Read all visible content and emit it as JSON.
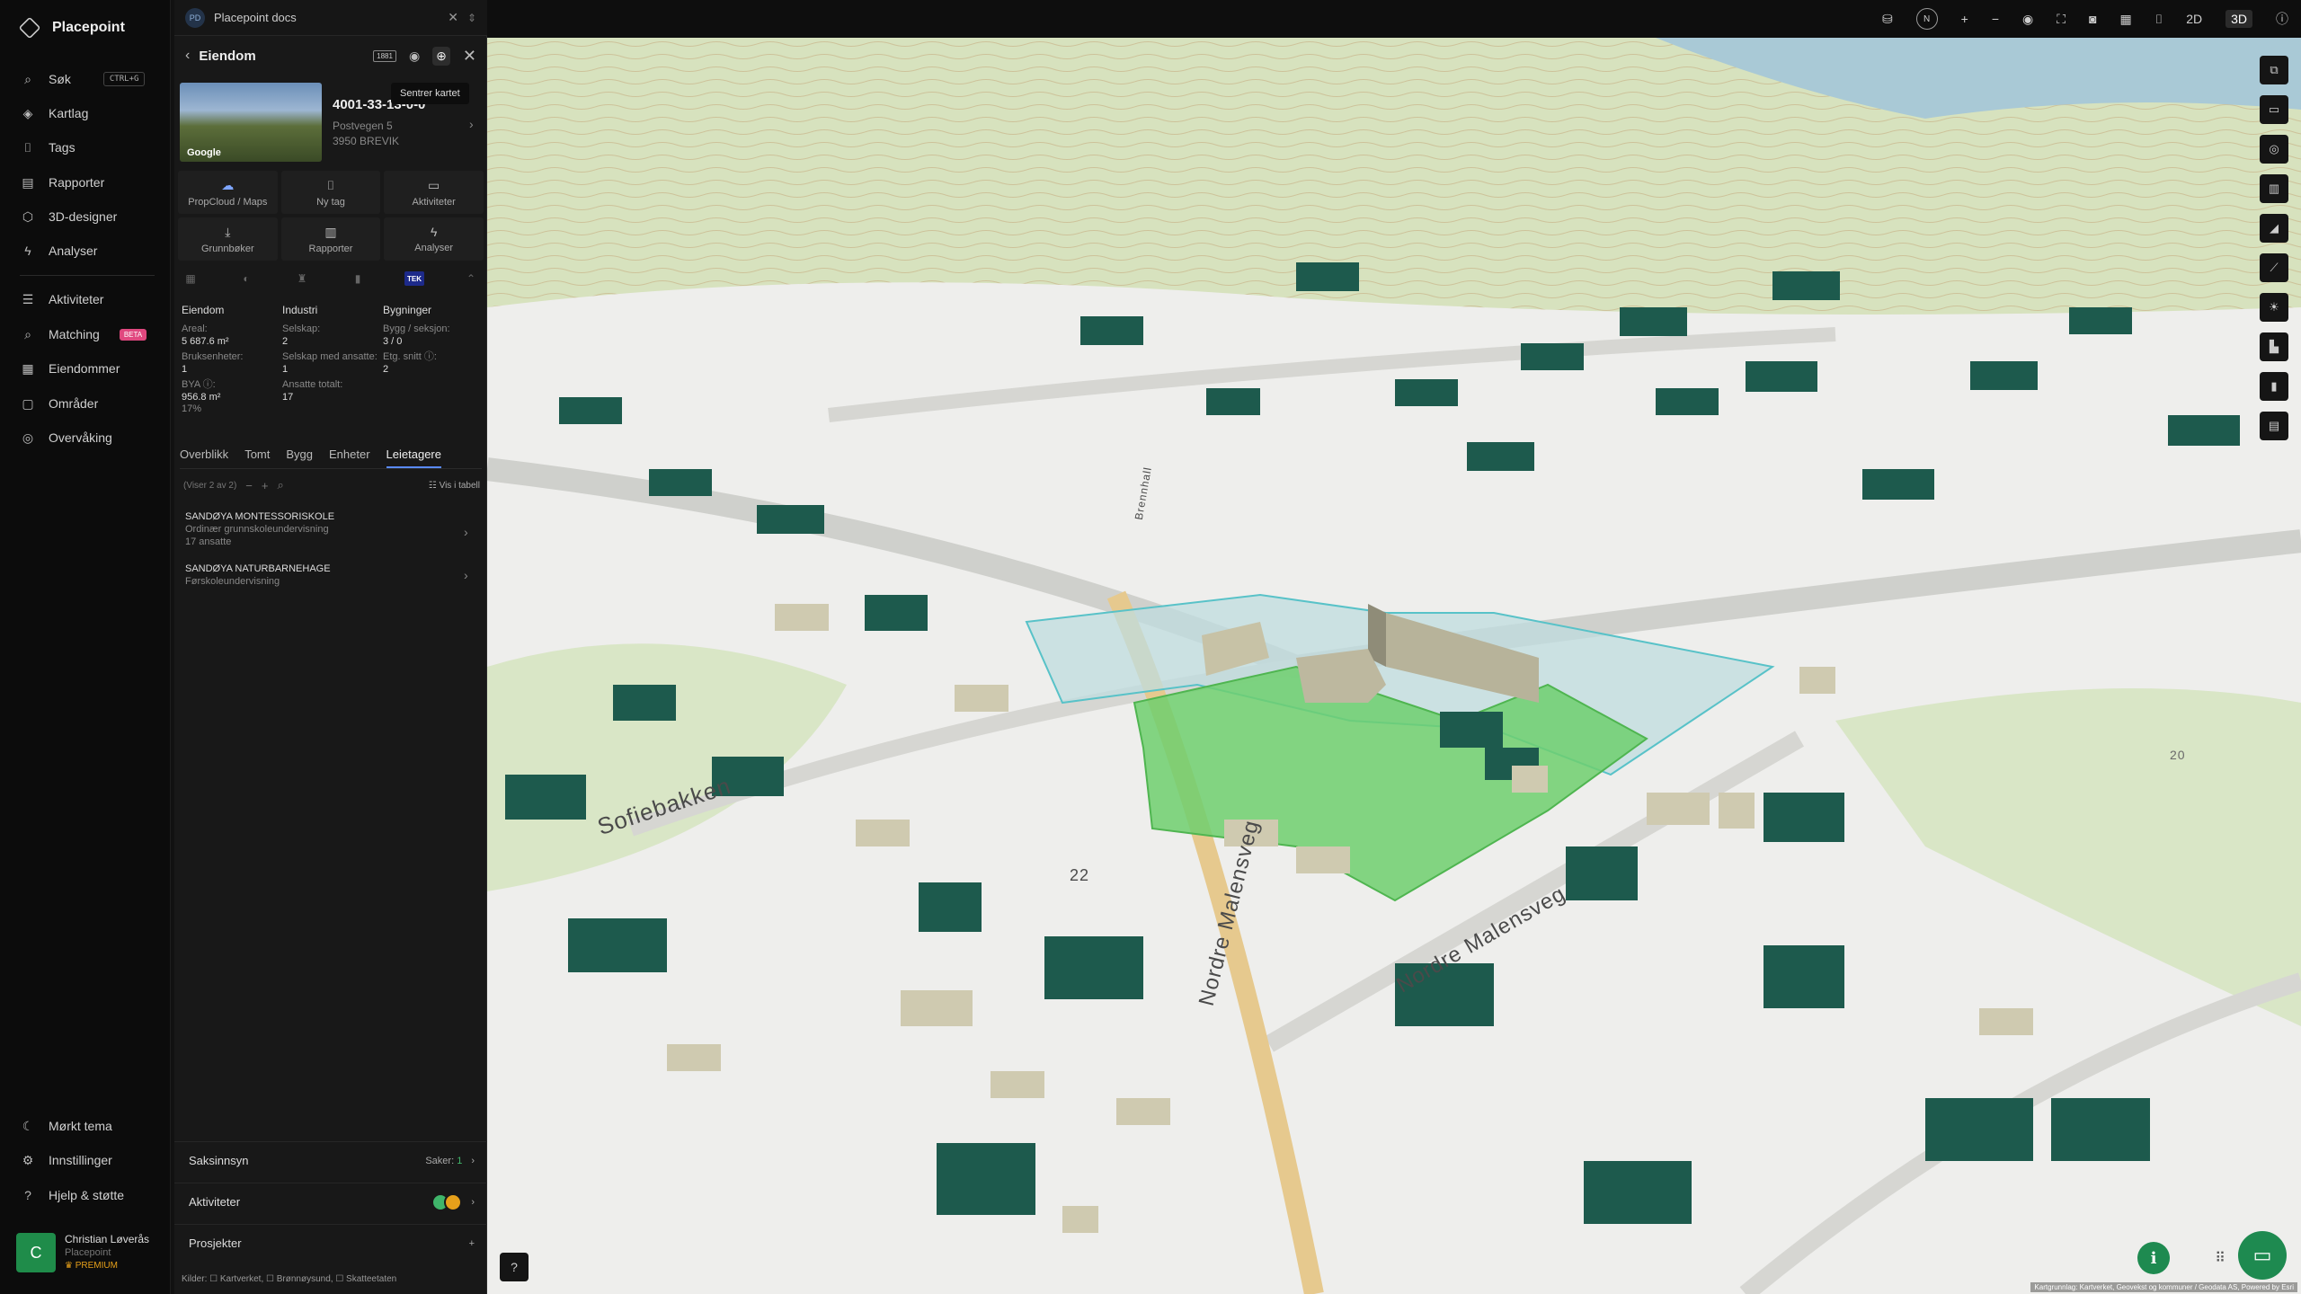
{
  "app": {
    "name": "Placepoint"
  },
  "nav": {
    "search": {
      "label": "Søk",
      "shortcut": "CTRL+G"
    },
    "items": [
      {
        "label": "Kartlag",
        "icon": "layers-icon"
      },
      {
        "label": "Tags",
        "icon": "bookmark-icon"
      },
      {
        "label": "Rapporter",
        "icon": "chart-icon"
      },
      {
        "label": "3D-designer",
        "icon": "cube-icon"
      },
      {
        "label": "Analyser",
        "icon": "bolt-icon"
      }
    ],
    "items2": [
      {
        "label": "Aktiviteter",
        "icon": "activity-icon"
      },
      {
        "label": "Matching",
        "icon": "match-icon",
        "badge": "BETA"
      },
      {
        "label": "Eiendommer",
        "icon": "building-icon"
      },
      {
        "label": "Områder",
        "icon": "area-icon"
      },
      {
        "label": "Overvåking",
        "icon": "monitor-icon"
      }
    ],
    "bottom": [
      {
        "label": "Mørkt tema",
        "icon": "moon-icon"
      },
      {
        "label": "Innstillinger",
        "icon": "gear-icon"
      },
      {
        "label": "Hjelp & støtte",
        "icon": "help-icon"
      }
    ],
    "user": {
      "initial": "C",
      "name": "Christian Løverås",
      "org": "Placepoint",
      "plan": "PREMIUM"
    }
  },
  "panel": {
    "doc": {
      "badge": "PD",
      "title": "Placepoint docs"
    },
    "header": {
      "title": "Eiendom",
      "badge": "1881"
    },
    "tooltip": "Sentrer kartet",
    "thumb_label": "Google",
    "property": {
      "id": "4001-33-13-0-0",
      "address1": "Postvegen 5",
      "address2": "3950 BREVIK"
    },
    "actions": [
      {
        "label": "PropCloud / Maps",
        "icon": "cloud-icon"
      },
      {
        "label": "Ny tag",
        "icon": "bookmark-icon"
      },
      {
        "label": "Aktiviteter",
        "icon": "chat-icon"
      },
      {
        "label": "Grunnbøker",
        "icon": "download-icon"
      },
      {
        "label": "Rapporter",
        "icon": "chart-icon"
      },
      {
        "label": "Analyser",
        "icon": "bolt-icon"
      }
    ],
    "tek_label": "TEK",
    "facts": {
      "eiendom": {
        "heading": "Eiendom",
        "areal_label": "Areal:",
        "areal": "5 687.6 m²",
        "bruks_label": "Bruksenheter:",
        "bruks": "1",
        "bya_label": "BYA ⓘ:",
        "bya": "956.8 m²",
        "bya_pct": "17%"
      },
      "industri": {
        "heading": "Industri",
        "selskap_label": "Selskap:",
        "selskap": "2",
        "ansatte_label": "Selskap med ansatte:",
        "ansatte": "1",
        "total_label": "Ansatte totalt:",
        "total": "17"
      },
      "bygninger": {
        "heading": "Bygninger",
        "bygg_label": "Bygg / seksjon:",
        "bygg": "3 / 0",
        "etg_label": "Etg. snitt ⓘ:",
        "etg": "2"
      }
    },
    "tabs": [
      "Overblikk",
      "Tomt",
      "Bygg",
      "Enheter",
      "Leietagere"
    ],
    "active_tab": "Leietagere",
    "list": {
      "count": "(Viser 2 av 2)",
      "table_link": "Vis i tabell"
    },
    "tenants": [
      {
        "name": "SANDØYA MONTESSORISKOLE",
        "desc": "Ordinær grunnskoleundervisning",
        "extra": "17 ansatte"
      },
      {
        "name": "SANDØYA NATURBARNEHAGE",
        "desc": "Førskoleundervisning",
        "extra": ""
      }
    ],
    "sections": {
      "saksinnsyn": {
        "label": "Saksinnsyn",
        "count_label": "Saker:",
        "count": "1"
      },
      "aktiviteter": {
        "label": "Aktiviteter"
      },
      "prosjekter": {
        "label": "Prosjekter"
      }
    },
    "sources": "Kilder: ☐ Kartverket, ☐ Brønnøysund, ☐ Skatteetaten"
  },
  "topbar": {
    "north": "N",
    "mode2d": "2D",
    "mode3d": "3D"
  },
  "map": {
    "labels": {
      "sofiebakken": "Sofiebakken",
      "nordre1": "Nordre Malensveg",
      "nordre2": "Nordre Malensveg",
      "brennhall": "Brennhall",
      "num": "22",
      "contour": "20"
    },
    "credits": "Kartgrunnlag: Kartverket, Geovekst og kommuner / Geodata AS, Powered by Esri"
  }
}
